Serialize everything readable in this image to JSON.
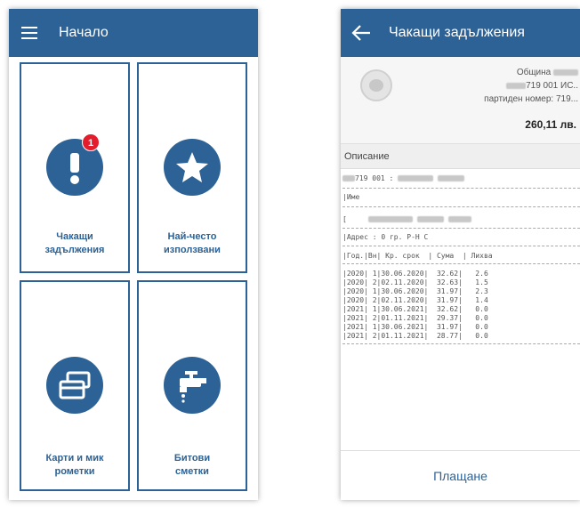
{
  "home": {
    "title": "Начало",
    "tiles": [
      {
        "line1": "Чакащи",
        "line2": "задължения",
        "icon": "alert-icon",
        "badge": "1"
      },
      {
        "line1": "Най-често",
        "line2": "използвани",
        "icon": "star-icon"
      },
      {
        "line1": "Карти и мик",
        "line2": "рометки",
        "icon": "cards-icon"
      },
      {
        "line1": "Битови",
        "line2": "сметки",
        "icon": "faucet-icon"
      }
    ]
  },
  "pending": {
    "title": "Чакащи задължения",
    "profile": {
      "line1": "Община",
      "line2": "719 001 ИС..",
      "line3": "партиден номер: 719...",
      "amount": "260,11 лв."
    },
    "section_label": "Описание",
    "receipt": {
      "line_code": "719 001 :",
      "name_label": "|Име",
      "address_label": "|Адрес : 0 гр. Р-Н С",
      "columns": "|Год.|Вн| Кр. срок  | Сума  | Лихва",
      "rows": [
        "|2020| 1|30.06.2020|  32.62|   2.6",
        "|2020| 2|02.11.2020|  32.63|   1.5",
        "|2020| 1|30.06.2020|  31.97|   2.3",
        "|2020| 2|02.11.2020|  31.97|   1.4",
        "|2021| 1|30.06.2021|  32.62|   0.0",
        "|2021| 2|01.11.2021|  29.37|   0.0",
        "|2021| 1|30.06.2021|  31.97|   0.0",
        "|2021| 2|01.11.2021|  28.77|   0.0"
      ]
    },
    "pay_label": "Плащане"
  },
  "colors": {
    "primary": "#2c6296",
    "badge": "#e41d2d"
  }
}
